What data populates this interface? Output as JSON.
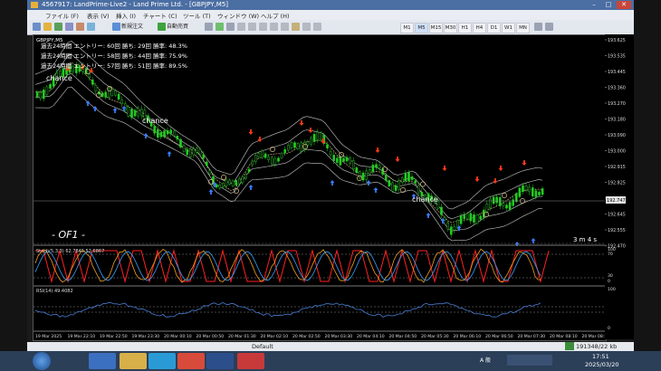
{
  "window": {
    "title": "4567917: LandPrime-Live2 - Land Prime Ltd. - [GBPJPY,M5]",
    "minimize": "–",
    "maximize": "□",
    "close": "✕"
  },
  "menu": {
    "items": [
      "ファイル (F)",
      "表示 (V)",
      "挿入 (I)",
      "チャート (C)",
      "ツール (T)",
      "ウィンドウ (W)",
      "ヘルプ (H)"
    ]
  },
  "toolbar": {
    "new_order_label": "新規注文",
    "auto_trade_label": "自動売買",
    "timeframes": [
      "M1",
      "M5",
      "M15",
      "M30",
      "H1",
      "H4",
      "D1",
      "W1",
      "MN"
    ]
  },
  "chart": {
    "symbol_label": "GBPJPY,M5",
    "stats": [
      "過去24時間  エントリー: 60回  勝ち: 29回  勝率: 48.3%",
      "過去24時間  エントリー: 58回  勝ち: 44回  勝率: 75.9%",
      "過去24時間  エントリー: 57回  勝ち: 51回  勝率: 89.5%"
    ],
    "chance_labels": [
      "chance",
      "chance",
      "chance"
    ],
    "brand": "- OF1 -",
    "timer": "3 m 4 s",
    "price_scale": [
      "193.625",
      "193.535",
      "193.445",
      "193.360",
      "193.270",
      "193.180",
      "193.090",
      "193.000",
      "192.915",
      "192.825",
      "192.735",
      "192.645",
      "192.555",
      "192.470"
    ],
    "current_price": "192.747",
    "oscillator_label": "Stoch(5,3,3) 62.7845 52.6867",
    "oscillator_scale": [
      "100",
      "70",
      "30",
      "0"
    ],
    "rsi_label": "RSI(14) 49.4082",
    "rsi_scale": [
      "100",
      "0"
    ],
    "time_axis": [
      "19 Mar 2025",
      "19 Mar 22:10",
      "19 Mar 22:50",
      "19 Mar 23:30",
      "20 Mar 00:10",
      "20 Mar 00:50",
      "20 Mar 01:30",
      "20 Mar 02:10",
      "20 Mar 02:50",
      "20 Mar 03:30",
      "20 Mar 04:10",
      "20 Mar 04:50",
      "20 Mar 05:30",
      "20 Mar 06:10",
      "20 Mar 06:50",
      "20 Mar 07:30",
      "20 Mar 08:10",
      "20 Mar 08:50"
    ]
  },
  "statusbar": {
    "profile": "Default",
    "traffic": "191348/22 kb"
  },
  "taskbar": {
    "time": "17:51",
    "date": "2025/03/20",
    "lang": "A 般"
  },
  "colors": {
    "bull_candle": "#22cc22",
    "bear_candle": "#111111",
    "buy_arrow": "#3a7bff",
    "sell_arrow": "#ff3a1a",
    "band": "#c8c8c8",
    "ma": "#e0c28a",
    "stoch_main": "#f0a020",
    "stoch_signal": "#3aa0ff",
    "signal_line": "#ff2020"
  }
}
